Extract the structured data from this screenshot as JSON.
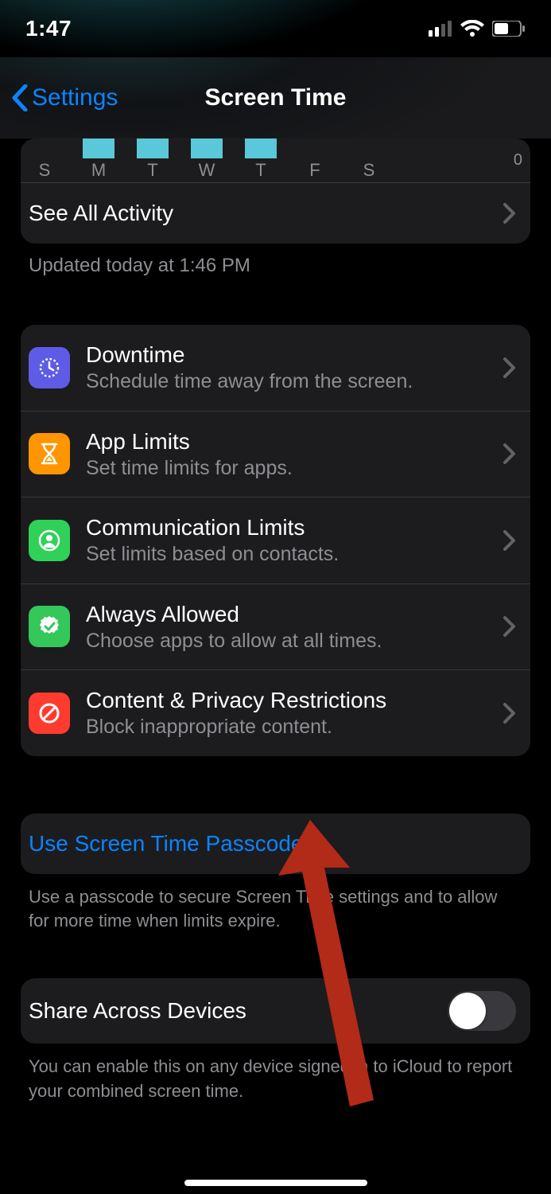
{
  "status": {
    "time": "1:47"
  },
  "nav": {
    "back": "Settings",
    "title": "Screen Time"
  },
  "chart_data": {
    "type": "bar",
    "categories": [
      "S",
      "M",
      "T",
      "W",
      "T",
      "F",
      "S"
    ],
    "values": [
      null,
      1,
      1,
      1,
      1,
      null,
      null
    ],
    "ylabel": "",
    "ylim": [
      0,
      1
    ],
    "zero_label": "0",
    "note": "top of chart is cropped; bars for M/T/W/T visible, heights unknown"
  },
  "see_all": "See All Activity",
  "updated": "Updated today at 1:46 PM",
  "rows": {
    "downtime": {
      "title": "Downtime",
      "sub": "Schedule time away from the screen."
    },
    "applimits": {
      "title": "App Limits",
      "sub": "Set time limits for apps."
    },
    "comm": {
      "title": "Communication Limits",
      "sub": "Set limits based on contacts."
    },
    "always": {
      "title": "Always Allowed",
      "sub": "Choose apps to allow at all times."
    },
    "content": {
      "title": "Content & Privacy Restrictions",
      "sub": "Block inappropriate content."
    }
  },
  "passcode": {
    "link": "Use Screen Time Passcode",
    "hint": "Use a passcode to secure Screen Time settings and to allow for more time when limits expire."
  },
  "share": {
    "label": "Share Across Devices",
    "on": false,
    "hint": "You can enable this on any device signed in to iCloud to report your combined screen time."
  }
}
